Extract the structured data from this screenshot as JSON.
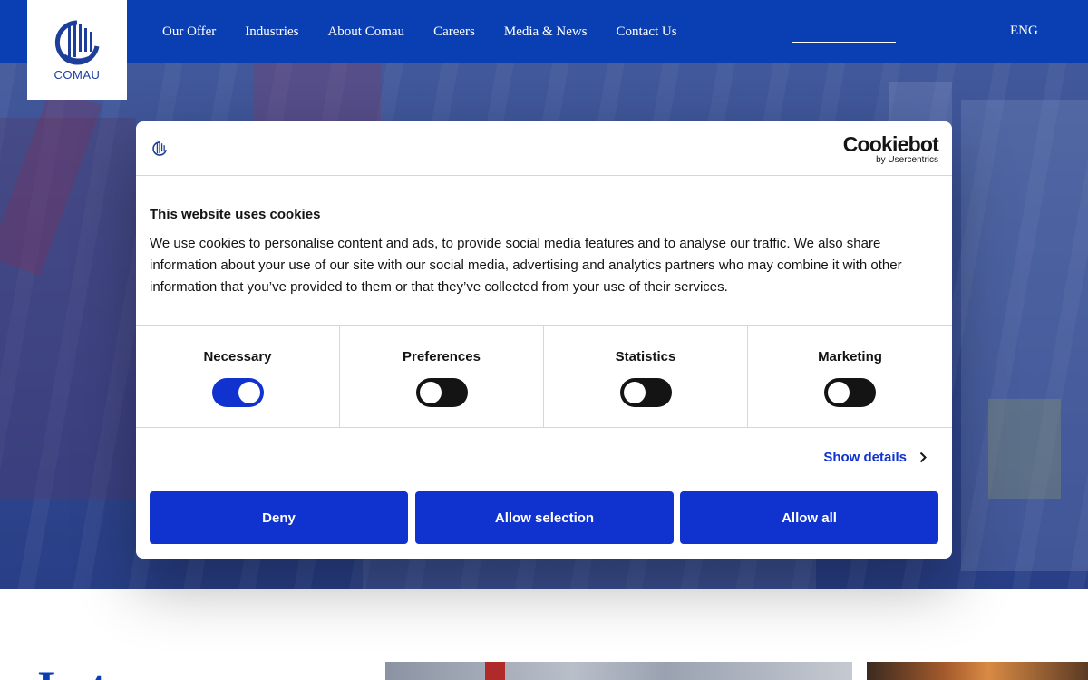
{
  "brand": {
    "name": "COMAU"
  },
  "nav": {
    "items": [
      {
        "label": "Our Offer"
      },
      {
        "label": "Industries"
      },
      {
        "label": "About Comau"
      },
      {
        "label": "Careers"
      },
      {
        "label": "Media & News"
      },
      {
        "label": "Contact Us"
      }
    ],
    "language": "ENG"
  },
  "cookie_dialog": {
    "provider_name": "Cookiebot",
    "provider_sub": "by Usercentrics",
    "title": "This website uses cookies",
    "body": "We use cookies to personalise content and ads, to provide social media features and to analyse our traffic. We also share information about your use of our site with our social media, advertising and analytics partners who may combine it with other information that you’ve provided to them or that they’ve collected from your use of their services.",
    "categories": [
      {
        "label": "Necessary",
        "enabled": true
      },
      {
        "label": "Preferences",
        "enabled": false
      },
      {
        "label": "Statistics",
        "enabled": false
      },
      {
        "label": "Marketing",
        "enabled": false
      }
    ],
    "show_details": "Show details",
    "buttons": {
      "deny": "Deny",
      "allow_selection": "Allow selection",
      "allow_all": "Allow all"
    }
  },
  "section": {
    "title_partial": "Lat..."
  },
  "colors": {
    "header": "#0a3fb3",
    "button": "#1032cf",
    "brand_text": "#1d3f9a"
  }
}
